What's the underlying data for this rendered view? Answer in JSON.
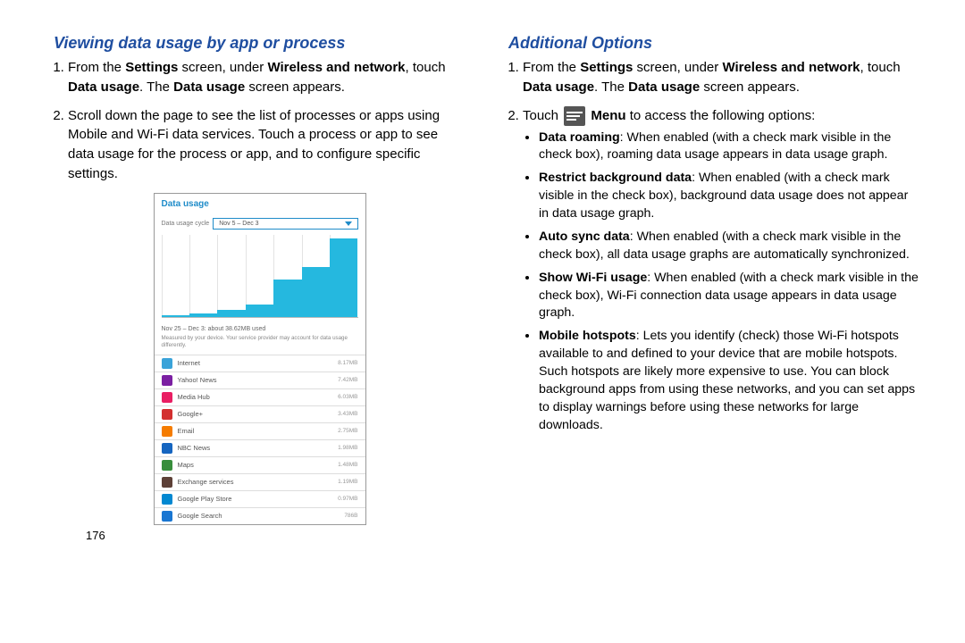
{
  "left": {
    "heading": "Viewing data usage by app or process",
    "step1_a": "From the ",
    "step1_b": "Settings",
    "step1_c": " screen, under ",
    "step1_d": "Wireless and network",
    "step1_e": ", touch ",
    "step1_f": "Data usage",
    "step1_g": ". The ",
    "step1_h": "Data usage",
    "step1_i": " screen appears.",
    "step2": "Scroll down the page to see the list of processes or apps using Mobile and Wi-Fi data services. Touch a process or app to see data usage for the process or app, and to configure specific settings.",
    "page_number": "176"
  },
  "phone": {
    "title": "Data usage",
    "cycle_label": "Data usage cycle",
    "cycle_value": "Nov 5 – Dec 3",
    "summary": "Nov 25 – Dec 3: about 38.62MB used",
    "note": "Measured by your device. Your service provider may account for data usage differently.",
    "apps": [
      {
        "name": "Internet",
        "val": "8.17MB",
        "color": "#3aa3d9"
      },
      {
        "name": "Yahoo! News",
        "val": "7.42MB",
        "color": "#7b1fa2"
      },
      {
        "name": "Media Hub",
        "val": "6.03MB",
        "color": "#e91e63"
      },
      {
        "name": "Google+",
        "val": "3.43MB",
        "color": "#d32f2f"
      },
      {
        "name": "Email",
        "val": "2.75MB",
        "color": "#f57c00"
      },
      {
        "name": "NBC News",
        "val": "1.98MB",
        "color": "#1565c0"
      },
      {
        "name": "Maps",
        "val": "1.48MB",
        "color": "#388e3c"
      },
      {
        "name": "Exchange services",
        "val": "1.19MB",
        "color": "#5d4037"
      },
      {
        "name": "Google Play Store",
        "val": "0.97MB",
        "color": "#0288d1"
      },
      {
        "name": "Google Search",
        "val": "786B",
        "color": "#1976d2"
      }
    ]
  },
  "chart_data": {
    "type": "bar",
    "title": "Data usage",
    "categories": [
      "",
      "",
      "",
      "",
      "",
      "",
      ""
    ],
    "values": [
      2,
      4,
      8,
      15,
      45,
      60,
      95
    ],
    "ylim": [
      0,
      100
    ],
    "xlabel": "Nov 5 – Dec 3",
    "ylabel": ""
  },
  "right": {
    "heading": "Additional Options",
    "step1_a": "From the ",
    "step1_b": "Settings",
    "step1_c": " screen, under ",
    "step1_d": "Wireless and network",
    "step1_e": ", touch ",
    "step1_f": "Data usage",
    "step1_g": ". The ",
    "step1_h": "Data usage",
    "step1_i": " screen appears.",
    "step2_a": "Touch ",
    "step2_b": "Menu",
    "step2_c": " to access the following options:",
    "opts": [
      {
        "t": "Data roaming",
        "d": ": When enabled (with a check mark visible in the check box), roaming data usage appears in data usage graph."
      },
      {
        "t": "Restrict background data",
        "d": ": When enabled (with a check mark visible in the check box), background data usage does not appear in data usage graph."
      },
      {
        "t": "Auto sync data",
        "d": ": When enabled (with a check mark visible in the check box), all data usage graphs are automatically synchronized."
      },
      {
        "t": "Show Wi-Fi usage",
        "d": ": When enabled (with a check mark visible in the check box), Wi-Fi connection data usage appears in data usage graph."
      },
      {
        "t": "Mobile hotspots",
        "d": ": Lets you identify (check) those Wi-Fi hotspots available to and defined to your device that are mobile hotspots. Such hotspots are likely more expensive to use. You can block background apps from using these networks, and you can set apps to display warnings before using these networks for large downloads."
      }
    ]
  }
}
